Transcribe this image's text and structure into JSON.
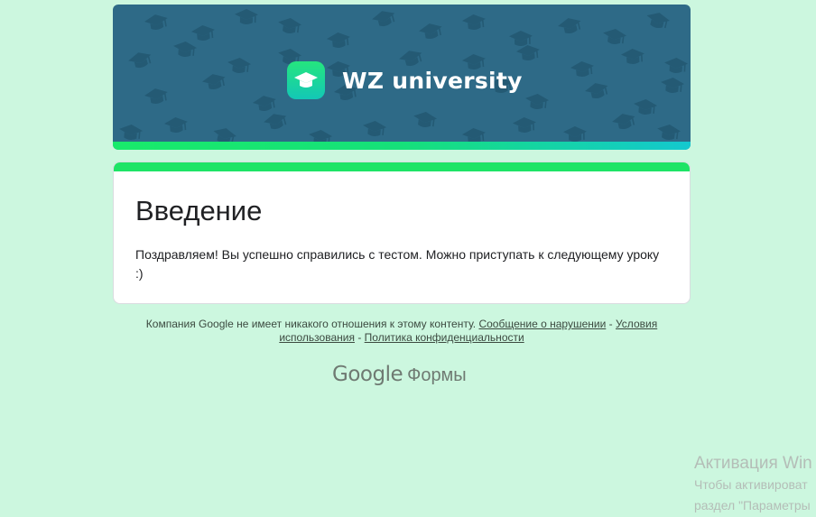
{
  "header": {
    "brand": "WZ university",
    "colors": {
      "banner_bg": "#2e6a87",
      "stripe_start": "#19ea6b",
      "stripe_end": "#14c8cf"
    },
    "logo_icon": "graduation-cap-icon",
    "pattern_icon": "graduation-cap-icon"
  },
  "card": {
    "title": "Введение",
    "description": "Поздравляем! Вы успешно справились с тестом. Можно приступать к следующему уроку :)",
    "accent_color": "#1ee466"
  },
  "footer": {
    "disclaimer": "Компания Google не имеет никакого отношения к этому контенту.",
    "report_link": "Сообщение о нарушении",
    "separator": "-",
    "terms_link": "Условия использования",
    "privacy_link": "Политика конфиденциальности",
    "logo_google": "Google",
    "logo_forms": "Формы"
  },
  "watermark": {
    "title": "Активация Win",
    "line1": "Чтобы активироват",
    "line2": "раздел \"Параметры"
  },
  "page_bg": "#ccf7df"
}
